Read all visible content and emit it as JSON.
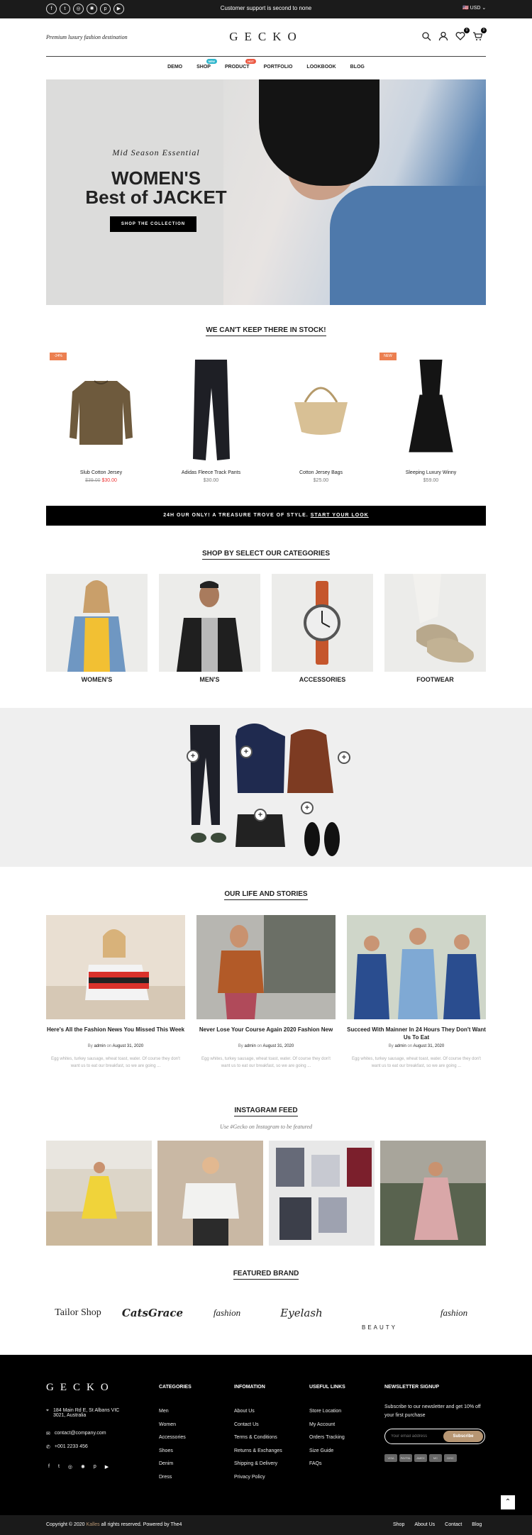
{
  "topbar": {
    "support": "Customer support is second to none",
    "currency": "USD",
    "social": [
      "facebook-icon",
      "twitter-icon",
      "instagram-icon",
      "dribbble-icon",
      "pinterest-icon",
      "youtube-icon"
    ]
  },
  "header": {
    "tagline": "Premium luxury fashion destination",
    "logo": "GECKO",
    "wishlist_count": "0",
    "cart_count": "0"
  },
  "nav": {
    "items": [
      {
        "label": "DEMO"
      },
      {
        "label": "SHOP",
        "tag": "NEW",
        "tag_color": "#2fb6cc"
      },
      {
        "label": "PRODUCT",
        "tag": "HOT",
        "tag_color": "#ec5a44"
      },
      {
        "label": "PORTFOLIO"
      },
      {
        "label": "LOOKBOOK"
      },
      {
        "label": "BLOG"
      }
    ]
  },
  "hero": {
    "subtitle": "Mid Season Essential",
    "title_line1": "WOMEN'S",
    "title_line2": "Best of JACKET",
    "button": "SHOP THE COLLECTION"
  },
  "stock_section": {
    "title": "WE CAN'T KEEP THERE IN STOCK!",
    "products": [
      {
        "name": "Slub Cotton Jersey",
        "old_price": "$39.00",
        "price": "$30.00",
        "badge": "-24%"
      },
      {
        "name": "Adidas Fleece Track Pants",
        "price": "$30.00"
      },
      {
        "name": "Cotton Jersey Bags",
        "price": "$25.00"
      },
      {
        "name": "Sleeping Luxury Winny",
        "price": "$59.00",
        "badge": "NEW"
      }
    ]
  },
  "promo_banner": {
    "text": "24H OUR ONLY! A TREASURE TROVE OF STYLE.",
    "link": "START YOUR LOOK"
  },
  "categories": {
    "title": "SHOP BY SELECT OUR CATEGORIES",
    "items": [
      "WOMEN'S",
      "MEN'S",
      "ACCESSORIES",
      "FOOTWEAR"
    ]
  },
  "stories": {
    "title": "OUR LIFE AND STORIES",
    "posts": [
      {
        "title": "Here's All the Fashion News You Missed This Week",
        "by": "By",
        "author": "admin",
        "on": "on",
        "date": "August 31, 2020",
        "excerpt": "Egg whites, turkey sausage, wheat toast, water. Of course they don't want us to eat our breakfast, so we are going ..."
      },
      {
        "title": "Never Lose Your Course Again 2020 Fashion New",
        "by": "By",
        "author": "admin",
        "on": "on",
        "date": "August 31, 2020",
        "excerpt": "Egg whites, turkey sausage, wheat toast, water. Of course they don't want us to eat our breakfast, so we are going ..."
      },
      {
        "title": "Succeed With Mainner In 24 Hours They Don't Want Us To Eat",
        "by": "By",
        "author": "admin",
        "on": "on",
        "date": "August 31, 2020",
        "excerpt": "Egg whites, turkey sausage, wheat toast, water. Of course they don't want us to eat our breakfast, so we are going ..."
      }
    ]
  },
  "instagram": {
    "title": "INSTAGRAM FEED",
    "subtitle": "Use #Gecko on Instagram to be featured"
  },
  "brands": {
    "title": "FEATURED BRAND",
    "items": [
      "Tailor Shop",
      "CatsGrace",
      "fashion",
      "Eyelash",
      "BEAUTY",
      "fashion"
    ]
  },
  "footer": {
    "logo": "GECKO",
    "address": "184 Main Rd E, St Albans VIC 3021, Australia",
    "email": "contact@company.com",
    "phone": "+001 2233 456",
    "categories_title": "CATEGORIES",
    "categories": [
      "Men",
      "Women",
      "Accessories",
      "Shoes",
      "Denim",
      "Dress"
    ],
    "info_title": "INFOMATION",
    "info": [
      "About Us",
      "Contact Us",
      "Terms & Conditions",
      "Returns & Exchanges",
      "Shipping & Delivery",
      "Privacy Policy"
    ],
    "useful_title": "USEFUL LINKS",
    "useful": [
      "Store Location",
      "My Account",
      "Orders Tracking",
      "Size Guide",
      "FAQs"
    ],
    "newsletter_title": "NEWSLETTER SIGNUP",
    "newsletter_text": "Subscribe to our newsletter and get 10% off your first purchase",
    "email_placeholder": "Your email address",
    "subscribe": "Subscribe",
    "payments": [
      "VISA",
      "PAYPAL",
      "AMEX",
      "MC",
      "DISC"
    ],
    "copyright_pre": "Copyright © 2020",
    "copyright_brand": "Kalles",
    "copyright_post": "all rights reserved. Powered by The4",
    "bottom_links": [
      "Shop",
      "About Us",
      "Contact",
      "Blog"
    ]
  }
}
